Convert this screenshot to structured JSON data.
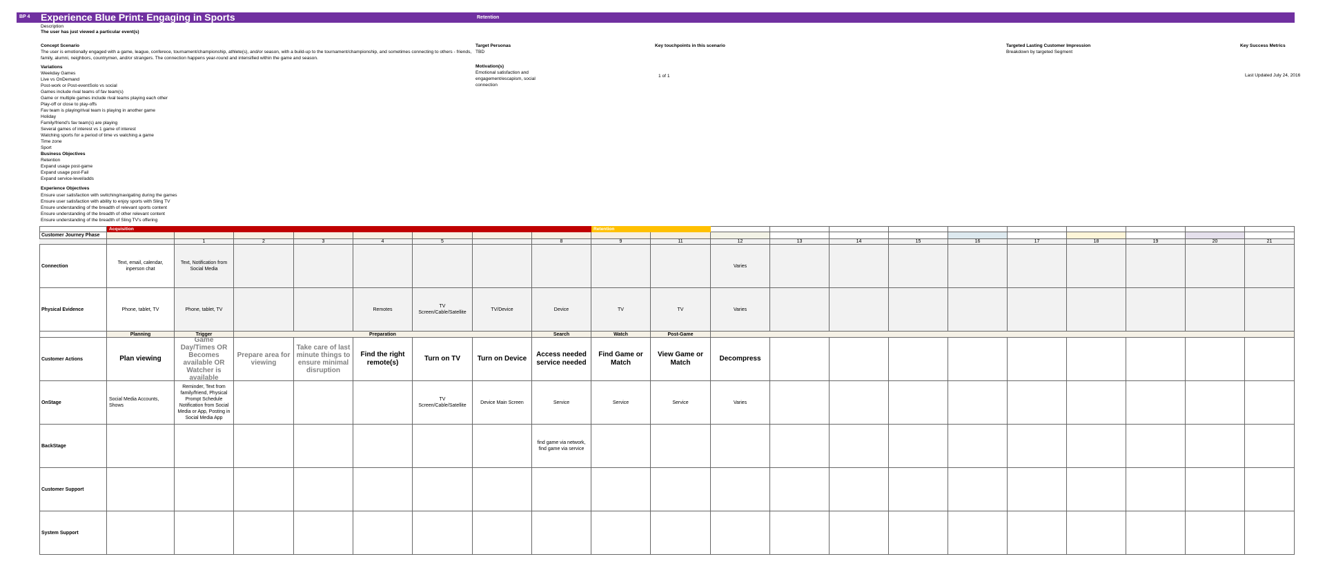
{
  "header": {
    "bp": "BP 4",
    "title": "Experience Blue Print: Engaging in Sports",
    "retention": "Retention",
    "color": "#7030a0"
  },
  "left": {
    "description_label": "Description",
    "description": "The user has just viewed a particular event(s)",
    "concept_label": "Concept Scenario",
    "concept_text": "The user is emotionally engaged with a game, league, conferece, tournament/championship, athlete(s), and/or season, with a build-up to the tournament/championship, and sometimes connecting to others - friends, family, alumni, neighbors, countrymen, and/or strangers. The connection happens year-round and intensified within the game and season.",
    "variations_label": "Variations",
    "variations": [
      "Weekday Games",
      "Live vs OnDemand",
      "Post-work or Post-eventSolo vs social",
      "Games include rival teams of fav team(s)",
      "Game or multiple games include rival teams playing each other",
      "Play-off or close to play-offs",
      "Fav team is playing/rival team is playing in another game",
      "Holiday",
      "Family/friend's fav team(s) are playing",
      "Several games of interest vs 1 game of interest",
      "Watching sports for a period of time vs watching a game",
      "Time zone",
      "Sport"
    ],
    "business_label": "Business Objectives",
    "business": [
      "Retention",
      "Expand usage post-game",
      "Expand usage post-Fail",
      "Expand service-level/adds"
    ],
    "experience_label": "Experience Objectives",
    "experience": [
      "Ensure user satisfaction with switching/navigating during the games",
      "Ensure user satisfaction with ability to enjoy sports with Sling TV",
      "Ensure understanding of the breadth of relevant sports content",
      "Ensure understanding of the breadth of other relevant content",
      "Ensure understanding of the breadth of Sling TV's offering"
    ]
  },
  "mid": {
    "target_label": "Target Personas",
    "target_value": "TBD",
    "motivation_label": "Motivation(s)",
    "motivation_value": "Emotional satisfaction and engagement/escapism, social connection",
    "key_touch_label": "Key touchpoints in this scenario",
    "page": "1 of 1",
    "impression_label": "Targeted Lasting Customer Impression",
    "impression_value": "Breakdown by targeted Segment",
    "kpi_label": "Key Success Metrics",
    "updated": "Last Updated  July 24, 2016"
  },
  "grid": {
    "band_acquisition": "Acquisition",
    "band_retention": "Retention",
    "colors": {
      "acquisition": "#c00000",
      "retention": "#ffc000"
    },
    "row_labels": {
      "journey": "Customer Journey Phase",
      "connection": "Connection",
      "physical": "Physical Evidence",
      "actions": "Customer Actions",
      "onstage": "OnStage",
      "backstage": "BackStage",
      "support": "Customer Support",
      "system": "System Support"
    },
    "col_numbers": [
      "",
      "1",
      "2",
      "3",
      "4",
      "5",
      "",
      "8",
      "9",
      "11",
      "12",
      "13",
      "14",
      "15",
      "16",
      "17",
      "18",
      "19",
      "20",
      "21"
    ],
    "phases": {
      "planning": "Planning",
      "trigger": "Trigger",
      "preparation": "Preparation",
      "search": "Search",
      "watch": "Watch",
      "postgame": "Post-Game"
    },
    "connection": [
      "Text, email, calendar, inperson chat",
      "Text, Notification from Social Media",
      "",
      "",
      "",
      "",
      "",
      "",
      "",
      "",
      "Varies"
    ],
    "physical": [
      "Phone, tablet, TV",
      "Phone, tablet, TV",
      "",
      "",
      "Remotes",
      "TV Screen/Cable/Satellite",
      "TV/Device",
      "Device",
      "TV",
      "TV",
      "Varies"
    ],
    "actions": [
      "Plan viewing",
      "Game Day/Times OR Becomes available OR Watcher is available",
      "Prepare area for viewing",
      "Take care of last minute things to ensure minimal disruption",
      "Find the right remote(s)",
      "Turn on TV",
      "Turn on Device",
      "Access needed service needed",
      "Find Game or Match",
      "View Game or Match",
      "Decompress"
    ],
    "onstage": [
      "Social Media Accounts, Shows",
      "Reminder, Text from family/friend, Physical Prompt Schedule Notification from Social Media or App, Posting in Social Media App",
      "",
      "",
      "",
      "TV Screen/Cable/Satellite",
      "Device Main Screen",
      "Service",
      "Service",
      "Service",
      "Varies"
    ],
    "backstage": [
      "",
      "",
      "",
      "",
      "",
      "",
      "",
      "find game via network, find game via service",
      "",
      "",
      ""
    ]
  }
}
